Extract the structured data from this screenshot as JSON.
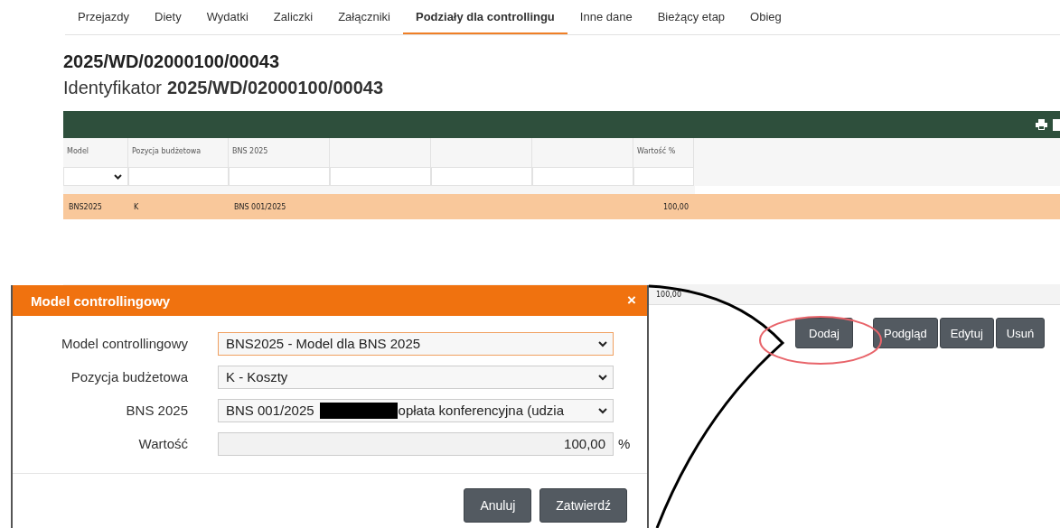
{
  "tabs": [
    {
      "label": "Przejazdy",
      "selected": false
    },
    {
      "label": "Diety",
      "selected": false
    },
    {
      "label": "Wydatki",
      "selected": false
    },
    {
      "label": "Zaliczki",
      "selected": false
    },
    {
      "label": "Załączniki",
      "selected": false
    },
    {
      "label": "Podziały dla controllingu",
      "selected": true
    },
    {
      "label": "Inne dane",
      "selected": false
    },
    {
      "label": "Bieżący etap",
      "selected": false
    },
    {
      "label": "Obieg",
      "selected": false
    }
  ],
  "heading": "2025/WD/02000100/00043",
  "identifier": {
    "label": "Identyfikator",
    "value": "2025/WD/02000100/00043"
  },
  "table": {
    "columns": [
      {
        "label": "Model",
        "kind": "select"
      },
      {
        "label": "Pozycja budżetowa",
        "kind": "text"
      },
      {
        "label": "BNS 2025",
        "kind": "text"
      },
      {
        "kind": "text"
      },
      {
        "kind": "text"
      },
      {
        "kind": "text"
      },
      {
        "label": "Wartość %",
        "kind": "text"
      }
    ],
    "rows": [
      {
        "model": "BNS2025",
        "position": "K",
        "bns": "BNS 001/2025",
        "value": "100,00",
        "selected": true
      }
    ],
    "total": "100,00"
  },
  "buttons": [
    "Dodaj",
    "Podgląd",
    "Edytuj",
    "Usuń"
  ],
  "dialog": {
    "title": "Model controllingowy",
    "close": "×",
    "fields": [
      {
        "label": "Model controllingowy",
        "kind": "select",
        "value": "BNS2025 - Model dla BNS 2025",
        "focused": true
      },
      {
        "label": "Pozycja budżetowa",
        "kind": "select",
        "value": "K - Koszty",
        "focused": false
      },
      {
        "label": "BNS 2025",
        "kind": "select",
        "value": "BNS 001/2025",
        "redacted": true,
        "value_rest": "opłata konferencyjna (udzia",
        "focused": false
      },
      {
        "label": "Wartość",
        "kind": "number",
        "value": "100,00",
        "unit": "%",
        "focused": false
      }
    ],
    "buttons": [
      "Anuluj",
      "Zatwierdź"
    ]
  }
}
